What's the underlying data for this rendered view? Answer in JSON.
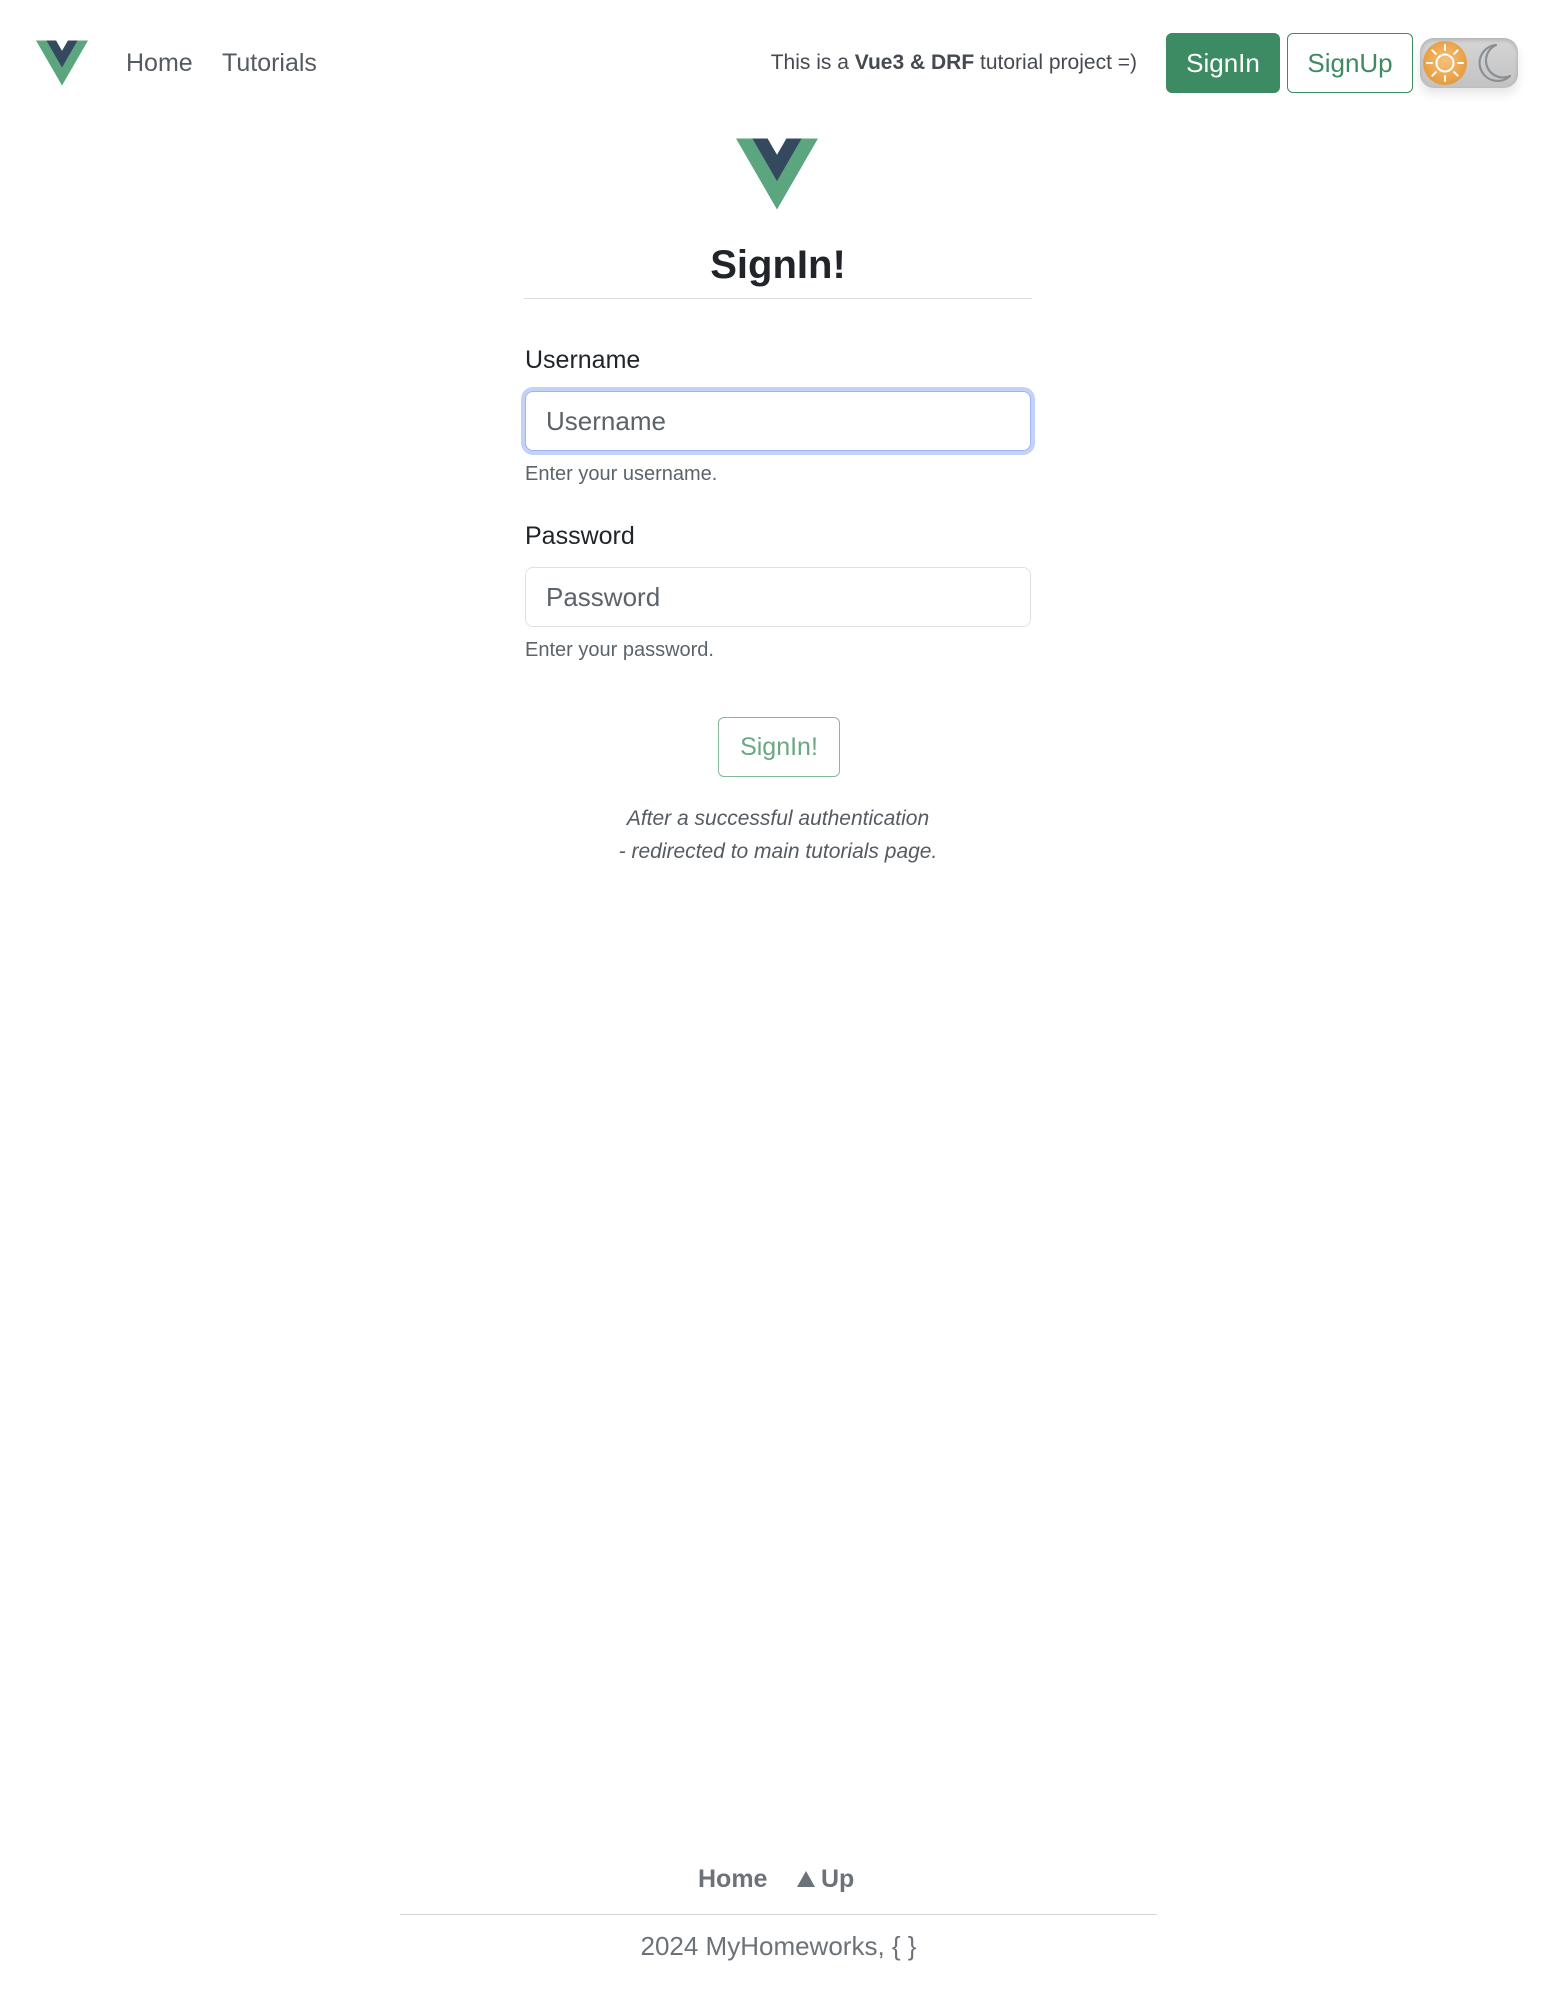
{
  "header": {
    "nav": [
      {
        "label": "Home"
      },
      {
        "label": "Tutorials"
      }
    ],
    "tagline": {
      "prefix": "This is a ",
      "bold": "Vue3 & DRF",
      "suffix": " tutorial project =)"
    },
    "signin_label": "SignIn",
    "signup_label": "SignUp",
    "theme_toggle": {
      "left_icon": "sun-icon",
      "right_icon": "moon-icon",
      "state": "light"
    }
  },
  "form": {
    "title": "SignIn!",
    "username": {
      "label": "Username",
      "placeholder": "Username",
      "value": "",
      "help": "Enter your username."
    },
    "password": {
      "label": "Password",
      "placeholder": "Password",
      "value": "",
      "help": "Enter your password."
    },
    "submit_label": "SignIn!",
    "note": [
      "After a successful authentication",
      "- redirected to main tutorials page."
    ]
  },
  "footer": {
    "links": [
      {
        "label": "Home"
      },
      {
        "label": "Up"
      }
    ],
    "copyright": "2024 MyHomeworks, { }"
  },
  "colors": {
    "brand_green": "#3d8b63",
    "vue_green": "#41b883",
    "vue_dark": "#35495e",
    "focus_ring": "#4c74e8"
  }
}
